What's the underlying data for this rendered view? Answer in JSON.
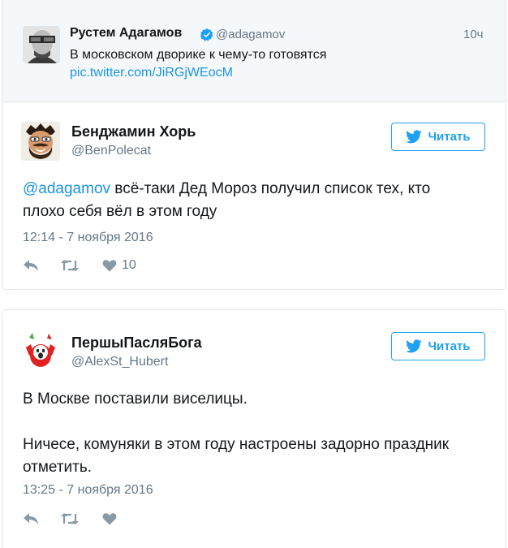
{
  "quoted": {
    "name": "Рустем Адагамов",
    "handle": "@adagamov",
    "time": "10ч",
    "text": "В московском дворике к чему-то готовятся",
    "link": "pic.twitter.com/JiRGjWEocM"
  },
  "tweets": [
    {
      "name": "Бенджамин Хорь",
      "handle": "@BenPolecat",
      "follow_label": "Читать",
      "mention": "@adagamov",
      "text_line1_rest": " всё-таки Дед Мороз получил список тех, кто",
      "text_line2": "плохо себя вёл в этом году",
      "date": "12:14 - 7 ноября 2016",
      "likes": "10"
    },
    {
      "name": "ПершыПасляБога",
      "handle": "@AlexSt_Hubert",
      "follow_label": "Читать",
      "paragraph1": "В Москве поставили виселицы.",
      "paragraph2_line1": "Ничесе, комуняки в этом году настроены задорно праздник",
      "paragraph2_line2": "отметить.",
      "date": "13:25 - 7 ноября 2016"
    }
  ],
  "colors": {
    "accent": "#1da1f2",
    "link": "#1b95e0",
    "muted": "#657786",
    "icon": "#8899a6",
    "quoted_bg": "#f5f8fa"
  },
  "icons": [
    "verified-badge-icon",
    "twitter-bird-icon",
    "reply-icon",
    "retweet-icon",
    "heart-icon"
  ]
}
